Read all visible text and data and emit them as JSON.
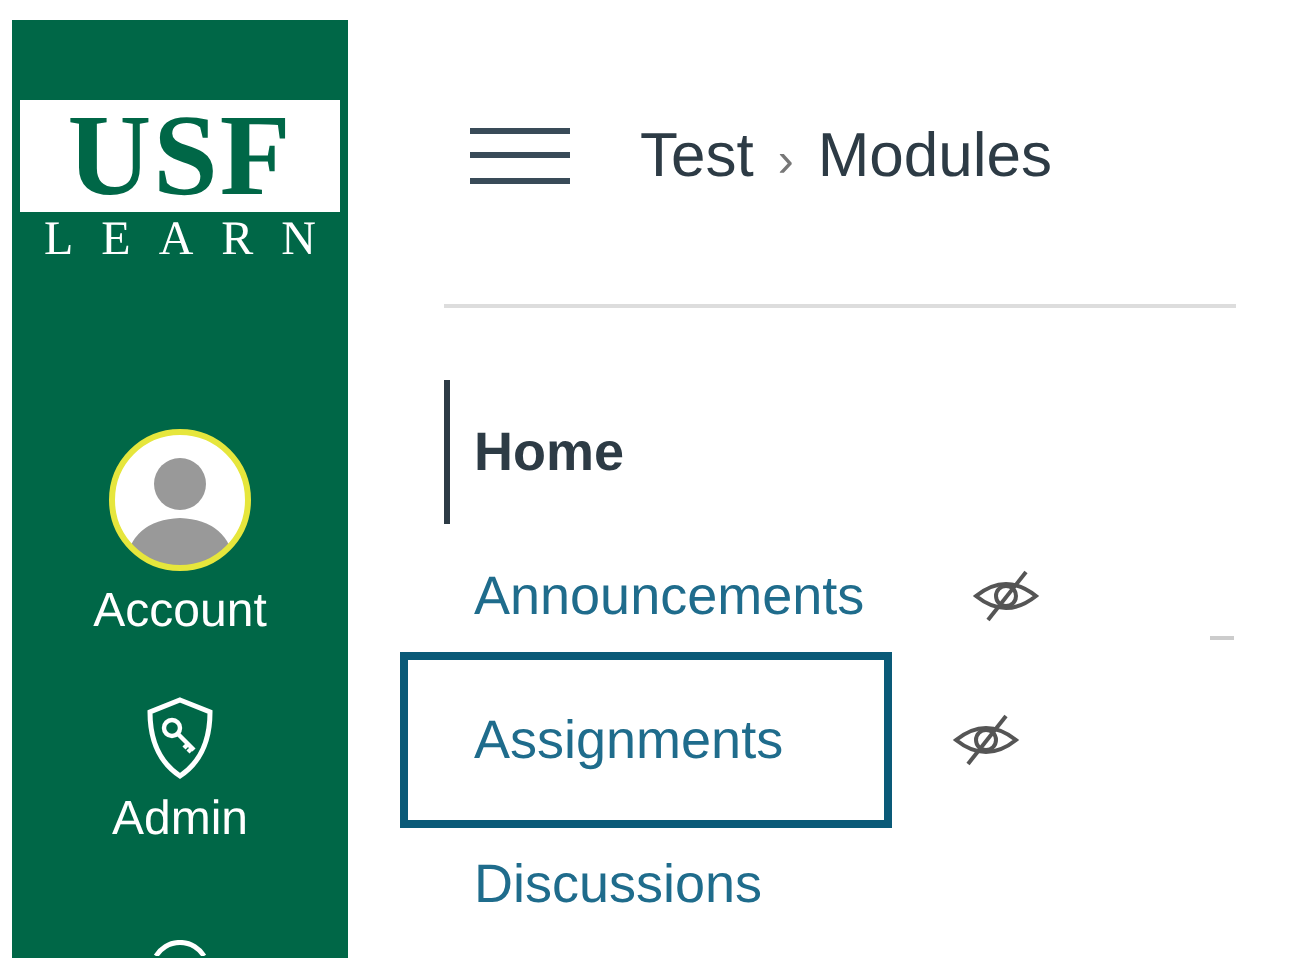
{
  "sidebar": {
    "logo": {
      "title": "USF",
      "subtitle": "LEARN"
    },
    "items": [
      {
        "kind": "account",
        "label": "Account"
      },
      {
        "kind": "admin",
        "label": "Admin"
      },
      {
        "kind": "partial"
      }
    ]
  },
  "header": {
    "breadcrumbs": [
      {
        "label": "Test"
      },
      {
        "label": "Modules"
      }
    ],
    "separator": "›"
  },
  "course_nav": [
    {
      "label": "Home",
      "selected": true,
      "hidden": false,
      "focused": false
    },
    {
      "label": "Announcements",
      "selected": false,
      "hidden": true,
      "focused": false
    },
    {
      "label": "Assignments",
      "selected": false,
      "hidden": true,
      "focused": true
    },
    {
      "label": "Discussions",
      "selected": false,
      "hidden": false,
      "focused": false
    }
  ]
}
